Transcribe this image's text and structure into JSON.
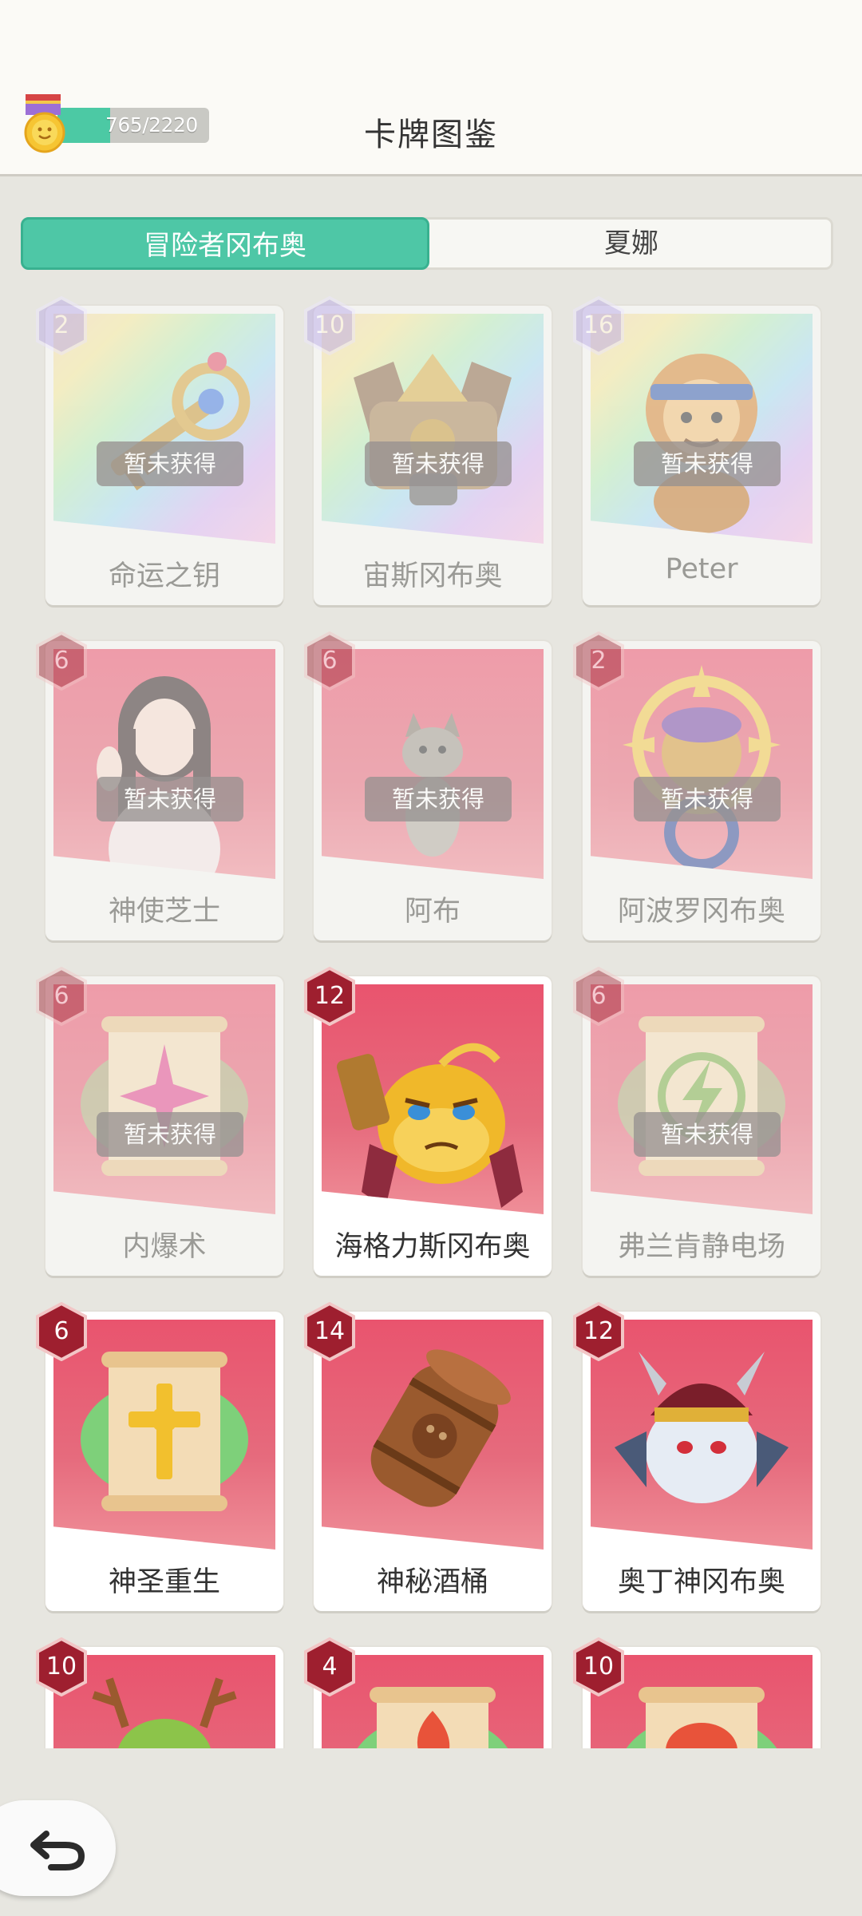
{
  "header": {
    "title": "卡牌图鉴",
    "progress_text": "765/2220",
    "progress_fraction": 0.345
  },
  "tabs": [
    {
      "label": "冒险者冈布奥",
      "active": true
    },
    {
      "label": "夏娜",
      "active": false
    }
  ],
  "locked_label": "暂未获得",
  "cards": [
    {
      "name": "命运之钥",
      "cost": "2",
      "locked": true,
      "style": "rainbow",
      "art": "key-icon"
    },
    {
      "name": "宙斯冈布奥",
      "cost": "10",
      "locked": true,
      "style": "rainbow",
      "art": "chest-icon"
    },
    {
      "name": "Peter",
      "cost": "16",
      "locked": true,
      "style": "rainbow",
      "art": "monkey-icon"
    },
    {
      "name": "神使芝士",
      "cost": "6",
      "locked": true,
      "style": "red",
      "art": "girl-portrait-icon"
    },
    {
      "name": "阿布",
      "cost": "6",
      "locked": true,
      "style": "red",
      "art": "cat-icon"
    },
    {
      "name": "阿波罗冈布奥",
      "cost": "2",
      "locked": true,
      "style": "red",
      "art": "sun-creature-icon"
    },
    {
      "name": "内爆术",
      "cost": "6",
      "locked": true,
      "style": "red",
      "art": "scroll-star-icon"
    },
    {
      "name": "海格力斯冈布奥",
      "cost": "12",
      "locked": false,
      "style": "red",
      "art": "hercules-blob-icon"
    },
    {
      "name": "弗兰肯静电场",
      "cost": "6",
      "locked": true,
      "style": "red",
      "art": "scroll-lightning-icon"
    },
    {
      "name": "神圣重生",
      "cost": "6",
      "locked": false,
      "style": "red",
      "art": "scroll-cross-icon"
    },
    {
      "name": "神秘酒桶",
      "cost": "14",
      "locked": false,
      "style": "red",
      "art": "barrel-icon"
    },
    {
      "name": "奥丁神冈布奥",
      "cost": "12",
      "locked": false,
      "style": "red",
      "art": "odin-blob-icon"
    },
    {
      "name": "",
      "cost": "10",
      "locked": false,
      "style": "red",
      "art": "antler-creature-icon"
    },
    {
      "name": "",
      "cost": "4",
      "locked": false,
      "style": "red",
      "art": "scroll-fire-icon"
    },
    {
      "name": "",
      "cost": "10",
      "locked": false,
      "style": "red",
      "art": "scroll-face-icon"
    }
  ],
  "colors": {
    "accent": "#4ec7a6",
    "card_red": "#e9546e",
    "badge_red": "#9e1f2f",
    "badge_purple": "#b6a4e6"
  }
}
